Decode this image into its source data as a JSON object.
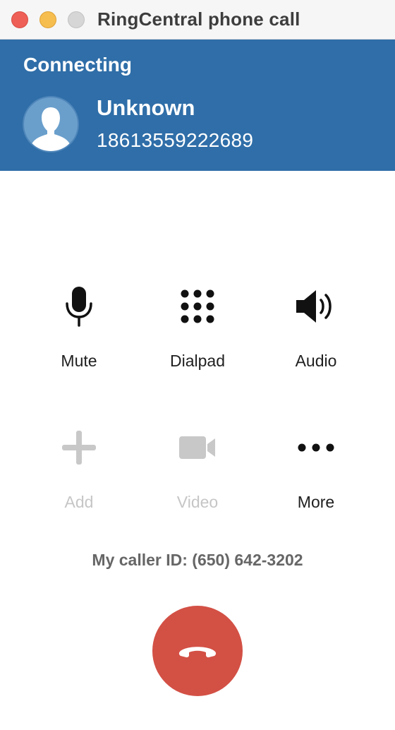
{
  "window": {
    "title": "RingCentral phone call"
  },
  "header": {
    "status": "Connecting",
    "caller_name": "Unknown",
    "caller_number": "18613559222689",
    "background_color": "#2f6ea8"
  },
  "actions": [
    {
      "label": "Mute",
      "icon": "microphone-icon",
      "enabled": true
    },
    {
      "label": "Dialpad",
      "icon": "dialpad-icon",
      "enabled": true
    },
    {
      "label": "Audio",
      "icon": "speaker-icon",
      "enabled": true
    },
    {
      "label": "Add",
      "icon": "plus-icon",
      "enabled": false
    },
    {
      "label": "Video",
      "icon": "video-camera-icon",
      "enabled": false
    },
    {
      "label": "More",
      "icon": "more-dots-icon",
      "enabled": true
    }
  ],
  "footer": {
    "caller_id": "My caller ID: (650) 642-3202"
  },
  "hangup": {
    "icon": "hang-up-phone-icon",
    "color": "#d35045"
  }
}
